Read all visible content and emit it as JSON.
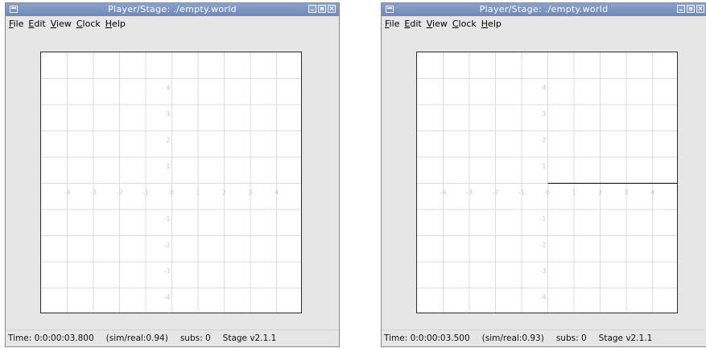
{
  "windows": [
    {
      "title": "Player/Stage: ./empty.world",
      "menu": [
        {
          "u": "F",
          "rest": "ile"
        },
        {
          "u": "E",
          "rest": "dit"
        },
        {
          "u": "V",
          "rest": "iew"
        },
        {
          "u": "C",
          "rest": "lock"
        },
        {
          "u": "H",
          "rest": "elp"
        }
      ],
      "status": {
        "time": "Time: 0:0:00:03.800",
        "ratio": "(sim/real:0.94)",
        "subs": "subs: 0",
        "version": "Stage v2.1.1"
      },
      "grid": {
        "x_ticks": [
          "-4",
          "-3",
          "-2",
          "-1",
          "0",
          "1",
          "2",
          "3",
          "4"
        ],
        "y_ticks": [
          "4",
          "3",
          "2",
          "1",
          "-1",
          "-2",
          "-3",
          "-4"
        ],
        "laser_visible": false
      }
    },
    {
      "title": "Player/Stage: ./empty.world",
      "menu": [
        {
          "u": "F",
          "rest": "ile"
        },
        {
          "u": "E",
          "rest": "dit"
        },
        {
          "u": "V",
          "rest": "iew"
        },
        {
          "u": "C",
          "rest": "lock"
        },
        {
          "u": "H",
          "rest": "elp"
        }
      ],
      "status": {
        "time": "Time: 0:0:00:03.500",
        "ratio": "(sim/real:0.93)",
        "subs": "subs: 0",
        "version": "Stage v2.1.1"
      },
      "grid": {
        "x_ticks": [
          "-4",
          "-3",
          "-2",
          "-1",
          "0",
          "1",
          "2",
          "3",
          "4"
        ],
        "y_ticks": [
          "4",
          "3",
          "2",
          "1",
          "-1",
          "-2",
          "-3",
          "-4"
        ],
        "laser_visible": true
      }
    }
  ],
  "colors": {
    "grid_line": "#dcdcdc",
    "tick_label": "#c8c8c8",
    "laser": "#000000"
  }
}
